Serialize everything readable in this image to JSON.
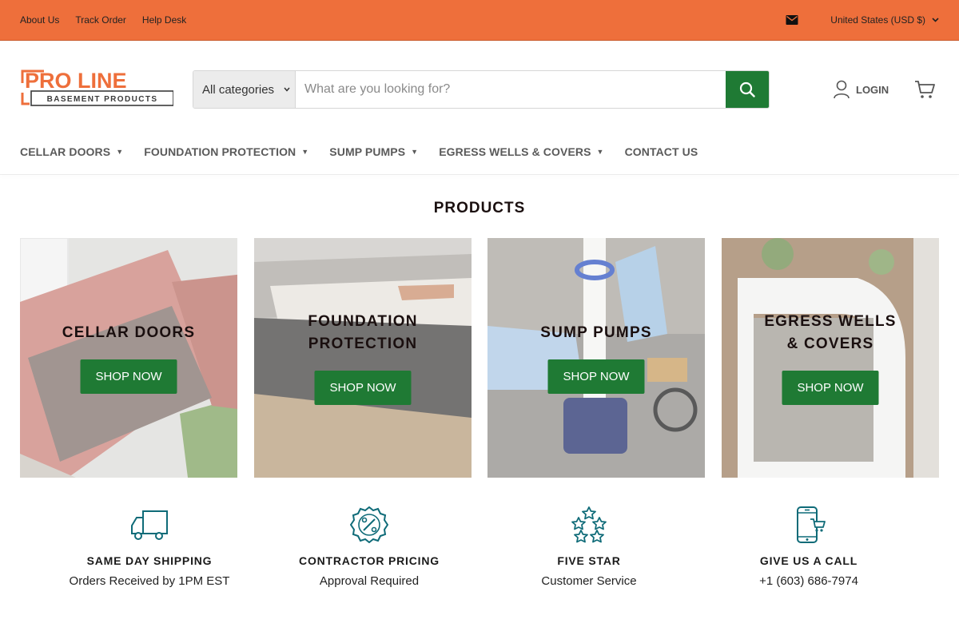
{
  "topbar": {
    "links": [
      "About Us",
      "Track Order",
      "Help Desk"
    ],
    "currency": "United States (USD $)",
    "color": "#ee6f3b"
  },
  "logo": {
    "line1": "PRO LINE",
    "line2": "BASEMENT PRODUCTS"
  },
  "search": {
    "category": "All categories",
    "placeholder": "What are you looking for?"
  },
  "account": {
    "login": "LOGIN"
  },
  "nav": [
    {
      "label": "CELLAR DOORS",
      "has_menu": true
    },
    {
      "label": "FOUNDATION PROTECTION",
      "has_menu": true
    },
    {
      "label": "SUMP PUMPS",
      "has_menu": true
    },
    {
      "label": "EGRESS WELLS & COVERS",
      "has_menu": true
    },
    {
      "label": "CONTACT US",
      "has_menu": false
    }
  ],
  "products": {
    "title": "PRODUCTS",
    "cards": [
      {
        "line1": "CELLAR DOORS",
        "line2": "",
        "button": "SHOP NOW"
      },
      {
        "line1": "FOUNDATION",
        "line2": "PROTECTION",
        "button": "SHOP NOW"
      },
      {
        "line1": "SUMP PUMPS",
        "line2": "",
        "button": "SHOP NOW"
      },
      {
        "line1": "EGRESS WELLS",
        "line2": "& COVERS",
        "button": "SHOP NOW"
      }
    ]
  },
  "features": [
    {
      "icon": "truck-icon",
      "title": "SAME DAY SHIPPING",
      "subtitle": "Orders Received by 1PM EST"
    },
    {
      "icon": "percent-badge-icon",
      "title": "CONTRACTOR PRICING",
      "subtitle": "Approval Required"
    },
    {
      "icon": "stars-icon",
      "title": "FIVE STAR",
      "subtitle": "Customer Service"
    },
    {
      "icon": "phone-cart-icon",
      "title": "GIVE US A CALL",
      "subtitle": "+1 (603) 686-7974"
    }
  ],
  "colors": {
    "accent": "#ee6f3b",
    "button_green": "#1f7a34",
    "icon_teal": "#0f6b78"
  }
}
